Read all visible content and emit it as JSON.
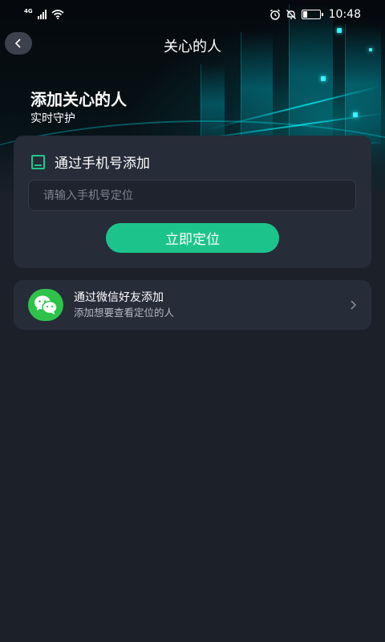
{
  "status_bar": {
    "network": "4G",
    "time": "10:48",
    "icons": [
      "signal-icon",
      "wifi-icon",
      "alarm-icon",
      "mute-icon",
      "battery-icon"
    ],
    "battery_level": 0.2
  },
  "nav": {
    "title": "关心的人",
    "back_icon": "chevron-left-icon"
  },
  "hero": {
    "title": "添加关心的人",
    "subtitle": "实时守护"
  },
  "phone_card": {
    "icon": "phone-icon",
    "heading": "通过手机号添加",
    "input_placeholder": "请输入手机号定位",
    "input_value": "",
    "button_label": "立即定位"
  },
  "wechat_card": {
    "icon": "wechat-icon",
    "title": "通过微信好友添加",
    "subtitle": "添加想要查看定位的人",
    "arrow_icon": "chevron-right-icon"
  },
  "colors": {
    "background": "#1b2029",
    "card": "#262c38",
    "accent": "#1cc48c",
    "wechat_green": "#2fc24b"
  }
}
